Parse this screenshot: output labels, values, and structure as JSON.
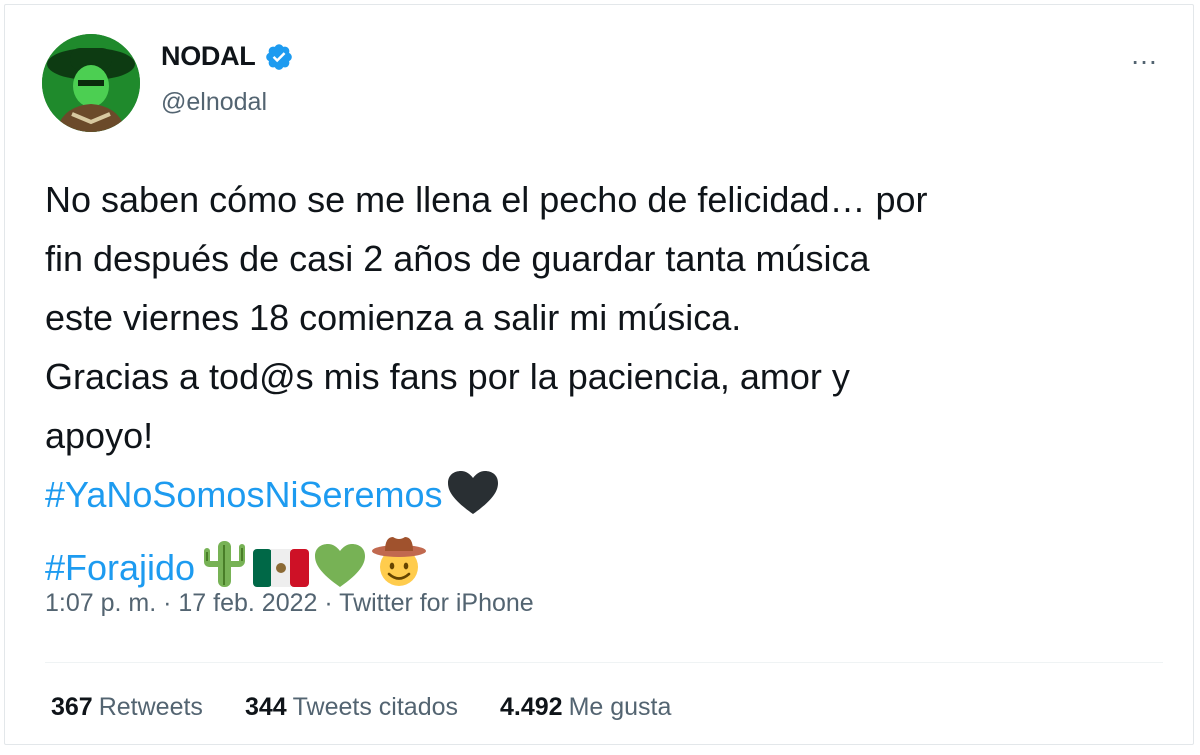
{
  "user": {
    "display_name": "NODAL",
    "handle": "@elnodal",
    "verified": true
  },
  "menu": {
    "more_label": "…"
  },
  "tweet": {
    "lines": [
      "No saben cómo se me llena el pecho de felicidad… por",
      "fin después de casi 2 años de guardar tanta música",
      "este viernes 18 comienza a salir mi música.",
      "Gracias a tod@s mis fans por la paciencia, amor y",
      "apoyo!"
    ],
    "hashtag_1": "#YaNoSomosNiSeremos",
    "hashtag_1_emojis": [
      "black-heart"
    ],
    "hashtag_2": "#Forajido",
    "hashtag_2_emojis": [
      "cactus",
      "mexico-flag",
      "green-heart",
      "cowboy-face"
    ]
  },
  "meta": {
    "time": "1:07 p. m.",
    "separator": " · ",
    "date": "17 feb. 2022",
    "source": "Twitter for iPhone"
  },
  "stats": {
    "retweets_count": "367",
    "retweets_label": "Retweets",
    "quotes_count": "344",
    "quotes_label": "Tweets citados",
    "likes_count": "4.492",
    "likes_label": "Me gusta"
  },
  "colors": {
    "link": "#1d9bf0",
    "secondary_text": "#536471",
    "verified_badge": "#1d9bf0"
  }
}
